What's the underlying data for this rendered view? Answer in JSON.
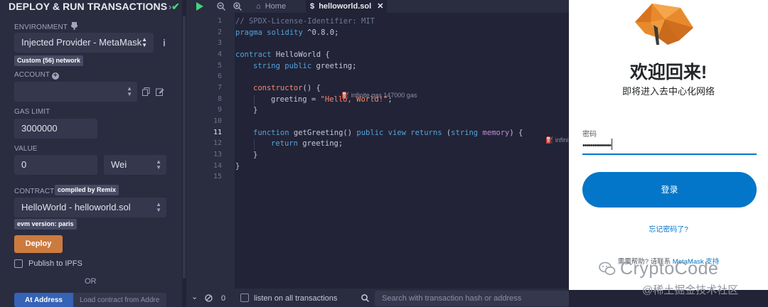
{
  "left_panel": {
    "title": "DEPLOY & RUN TRANSACTIONS",
    "environment": {
      "label": "ENVIRONMENT",
      "value": "Injected Provider - MetaMask",
      "network_badge": "Custom (56) network"
    },
    "account": {
      "label": "ACCOUNT",
      "value": ""
    },
    "gas_limit": {
      "label": "GAS LIMIT",
      "value": "3000000"
    },
    "value": {
      "label": "VALUE",
      "amount": "0",
      "unit": "Wei"
    },
    "contract": {
      "label": "CONTRACT",
      "compiled_badge": "compiled by Remix",
      "value": "HelloWorld - helloworld.sol",
      "evm_badge": "evm version: paris"
    },
    "deploy_label": "Deploy",
    "publish_label": "Publish to IPFS",
    "or_label": "OR",
    "at_address_label": "At Address",
    "load_placeholder": "Load contract from Addre"
  },
  "editor": {
    "tabs": {
      "home": "Home",
      "file": "helloworld.sol"
    },
    "line_numbers": [
      "1",
      "2",
      "3",
      "4",
      "5",
      "6",
      "7",
      "8",
      "9",
      "10",
      "11",
      "12",
      "13",
      "14",
      "15"
    ],
    "current_line": "11",
    "code": {
      "l1": "// SPDX-License-Identifier: MIT",
      "l2_kw": "pragma solidity",
      "l2_val": " ^0.8.0;",
      "l4_kw": "contract",
      "l4_name": " HelloWorld {",
      "l5_kw": "string public",
      "l5_rest": " greeting;",
      "l7_kw": "constructor",
      "l7_rest": "() {",
      "l7_gas": "infinite gas 147000 gas",
      "l8_a": "greeting = ",
      "l8_str": "\"Hello, World!\"",
      "l8_b": ";",
      "l9": "}",
      "l11_kw1": "function",
      "l11_name": " getGreeting() ",
      "l11_kw2": "public view returns",
      "l11_p1": " (",
      "l11_ty": "string",
      "l11_mem": " memory",
      "l11_p2": ") {",
      "l11_gas": "infini",
      "l12_kw": "return",
      "l12_rest": " greeting;",
      "l13": "}",
      "l14": "}"
    }
  },
  "terminal": {
    "count": "0",
    "listen_label": "listen on all transactions",
    "search_placeholder": "Search with transaction hash or address"
  },
  "metamask": {
    "welcome": "欢迎回来!",
    "subtitle": "即将进入去中心化网络",
    "password_label": "密码",
    "password_value": "••••••••••••••",
    "login_label": "登录",
    "forgot_label": "忘记密码了?",
    "help_prefix": "需要帮助? 请联系 ",
    "help_link": "MetaMask 支持"
  },
  "watermark": {
    "brand": "CryptoCode",
    "community": "@稀土掘金技术社区"
  },
  "colors": {
    "accent_green": "#45d17b",
    "deploy_orange": "#cc7b3f",
    "at_address_blue": "#3563b5",
    "metamask_blue": "#0376c9",
    "fox_orange": "#e88a2c"
  }
}
